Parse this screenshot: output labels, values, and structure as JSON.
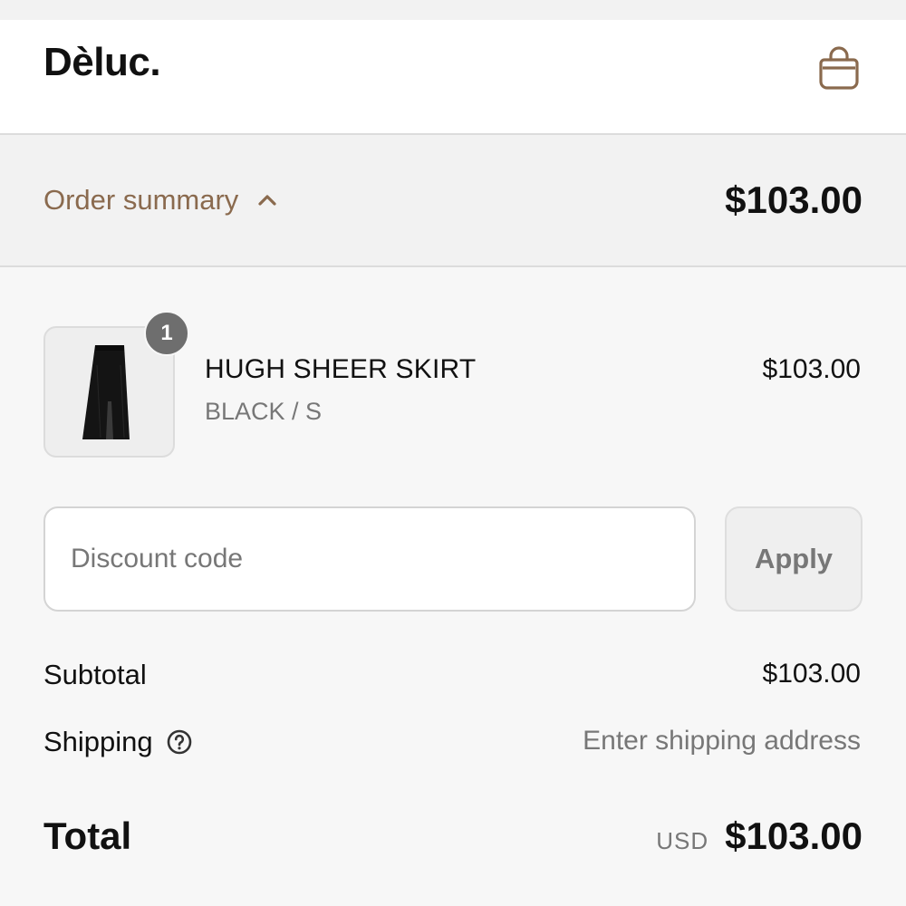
{
  "header": {
    "brand": "Dèluc.",
    "cart_icon": "shopping-bag-icon"
  },
  "summary": {
    "toggle_label": "Order summary",
    "toggle_icon": "chevron-up-icon",
    "total": "$103.00"
  },
  "items": [
    {
      "name": "HUGH SHEER SKIRT",
      "variant": "BLACK / S",
      "price": "$103.00",
      "quantity": "1",
      "image_icon": "black-skirt-thumbnail"
    }
  ],
  "discount": {
    "placeholder": "Discount code",
    "apply_label": "Apply"
  },
  "totals": {
    "subtotal_label": "Subtotal",
    "subtotal_value": "$103.00",
    "shipping_label": "Shipping",
    "shipping_help_icon": "question-circle-icon",
    "shipping_value": "Enter shipping address",
    "total_label": "Total",
    "currency": "USD",
    "total_value": "$103.00"
  },
  "colors": {
    "accent": "#8a6a4e",
    "text": "#111111",
    "muted": "#777777",
    "badge": "#6e6e6e"
  }
}
